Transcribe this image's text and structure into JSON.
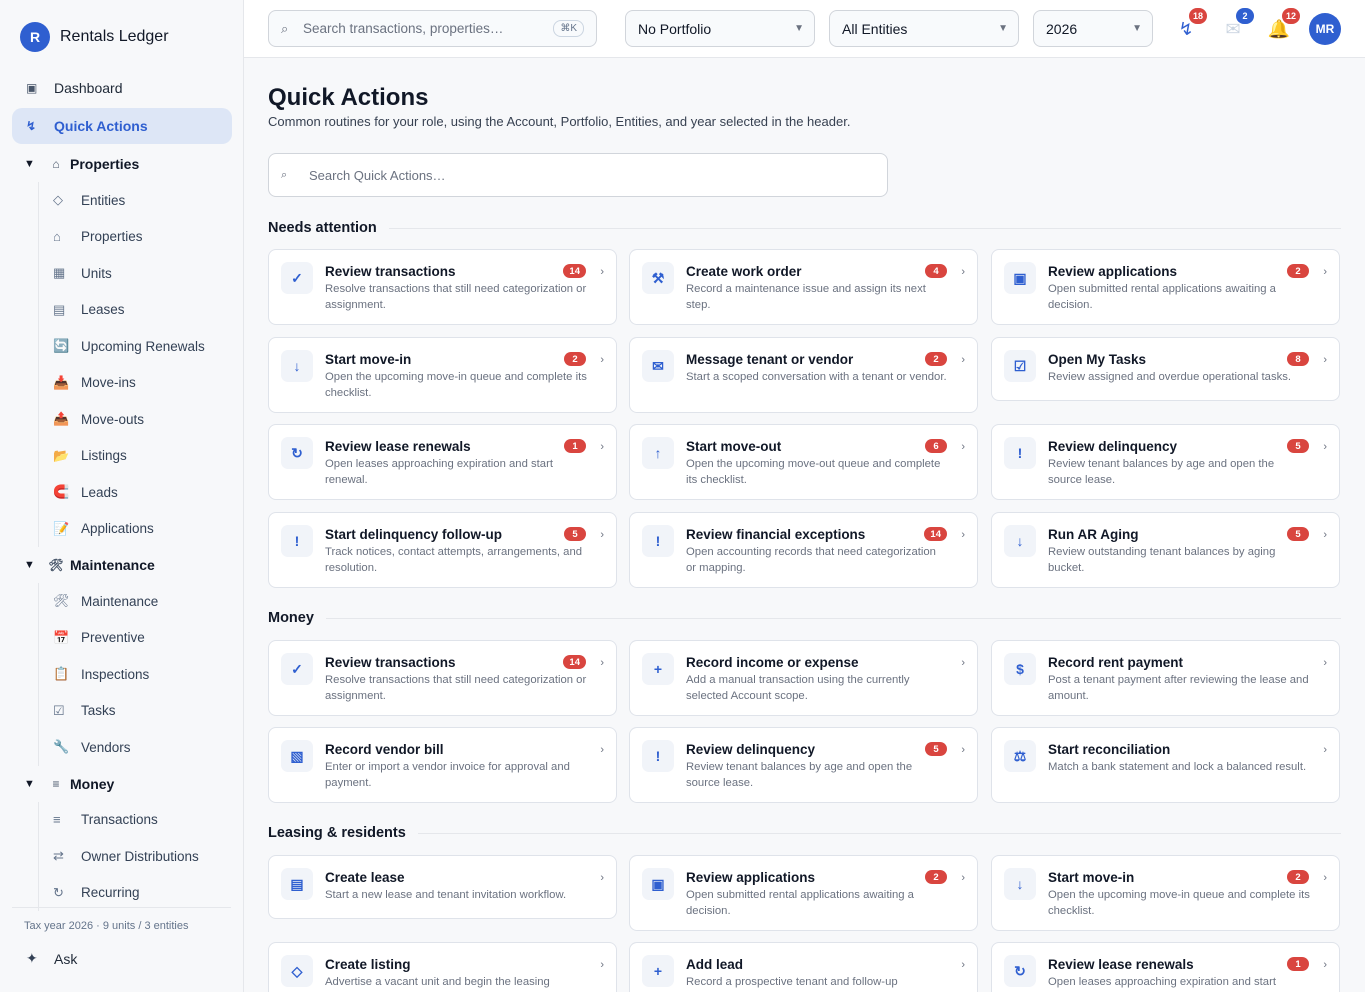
{
  "brand": {
    "initial": "R",
    "name": "Rentals Ledger"
  },
  "nav": [
    {
      "label": "Dashboard",
      "icon": "dashboard-icon",
      "glyph": "▣"
    },
    {
      "label": "Quick Actions",
      "icon": "lightning-icon",
      "glyph": "↯",
      "active": true
    }
  ],
  "groups": [
    {
      "label": "Properties",
      "icon": "home-icon",
      "glyph": "⌂",
      "items": [
        {
          "label": "Entities",
          "icon": "diamond-icon",
          "glyph": "◇"
        },
        {
          "label": "Properties",
          "icon": "home-icon",
          "glyph": "⌂"
        },
        {
          "label": "Units",
          "icon": "grid-icon",
          "glyph": "▦"
        },
        {
          "label": "Leases",
          "icon": "document-icon",
          "glyph": "▤"
        },
        {
          "label": "Upcoming Renewals",
          "icon": "renew-icon",
          "glyph": "🔄"
        },
        {
          "label": "Move-ins",
          "icon": "inbox-in-icon",
          "glyph": "📥"
        },
        {
          "label": "Move-outs",
          "icon": "inbox-out-icon",
          "glyph": "📤"
        },
        {
          "label": "Listings",
          "icon": "folder-icon",
          "glyph": "📂"
        },
        {
          "label": "Leads",
          "icon": "magnet-icon",
          "glyph": "🧲"
        },
        {
          "label": "Applications",
          "icon": "memo-icon",
          "glyph": "📝"
        }
      ]
    },
    {
      "label": "Maintenance",
      "icon": "tools-icon",
      "glyph": "🛠",
      "items": [
        {
          "label": "Maintenance",
          "icon": "tools-icon",
          "glyph": "🛠"
        },
        {
          "label": "Preventive",
          "icon": "calendar-icon",
          "glyph": "📅"
        },
        {
          "label": "Inspections",
          "icon": "clipboard-icon",
          "glyph": "📋"
        },
        {
          "label": "Tasks",
          "icon": "checkbox-icon",
          "glyph": "☑"
        },
        {
          "label": "Vendors",
          "icon": "wrench-icon",
          "glyph": "🔧"
        }
      ]
    },
    {
      "label": "Money",
      "icon": "money-icon",
      "glyph": "≡",
      "items": [
        {
          "label": "Transactions",
          "icon": "list-icon",
          "glyph": "≡"
        },
        {
          "label": "Owner Distributions",
          "icon": "transfer-icon",
          "glyph": "⇄"
        },
        {
          "label": "Recurring",
          "icon": "recurring-icon",
          "glyph": "↻"
        }
      ]
    }
  ],
  "sidebar_footer": "Tax year 2026 · 9 units / 3 entities",
  "ask": {
    "label": "Ask",
    "glyph": "✦"
  },
  "header": {
    "search_placeholder": "Search transactions, properties…",
    "search_shortcut": "⌘K",
    "portfolio": "No Portfolio",
    "entities": "All Entities",
    "year": "2026",
    "icons": [
      {
        "name": "lightning-icon",
        "glyph": "↯",
        "badge": "18",
        "badge_color": "#d9453f",
        "color": "#2f5fd0"
      },
      {
        "name": "mail-icon",
        "glyph": "✉",
        "badge": "2",
        "badge_color": "#2f5fd0",
        "color": "#cbd5e1"
      },
      {
        "name": "bell-icon",
        "glyph": "🔔",
        "badge": "12",
        "badge_color": "#d9453f",
        "color": "#eab308"
      }
    ],
    "avatar": "MR"
  },
  "page": {
    "title": "Quick Actions",
    "subtitle": "Common routines for your role, using the Account, Portfolio, Entities, and year selected in the header.",
    "search_placeholder": "Search Quick Actions…",
    "search_glyph": "⌕"
  },
  "sections": [
    {
      "title": "Needs attention",
      "cards": [
        {
          "title": "Review transactions",
          "desc": "Resolve transactions that still need categorization or assignment.",
          "badge": "14",
          "icon": "check-icon",
          "glyph": "✓"
        },
        {
          "title": "Create work order",
          "desc": "Record a maintenance issue and assign its next step.",
          "badge": "4",
          "icon": "tools-icon",
          "glyph": "⚒"
        },
        {
          "title": "Review applications",
          "desc": "Open submitted rental applications awaiting a decision.",
          "badge": "2",
          "icon": "application-icon",
          "glyph": "▣"
        },
        {
          "title": "Start move-in",
          "desc": "Open the upcoming move-in queue and complete its checklist.",
          "badge": "2",
          "icon": "arrow-down-icon",
          "glyph": "↓"
        },
        {
          "title": "Message tenant or vendor",
          "desc": "Start a scoped conversation with a tenant or vendor.",
          "badge": "2",
          "icon": "mail-icon",
          "glyph": "✉"
        },
        {
          "title": "Open My Tasks",
          "desc": "Review assigned and overdue operational tasks.",
          "badge": "8",
          "icon": "checkbox-icon",
          "glyph": "☑"
        },
        {
          "title": "Review lease renewals",
          "desc": "Open leases approaching expiration and start renewal.",
          "badge": "1",
          "icon": "refresh-icon",
          "glyph": "↻"
        },
        {
          "title": "Start move-out",
          "desc": "Open the upcoming move-out queue and complete its checklist.",
          "badge": "6",
          "icon": "arrow-up-icon",
          "glyph": "↑"
        },
        {
          "title": "Review delinquency",
          "desc": "Review tenant balances by age and open the source lease.",
          "badge": "5",
          "icon": "alert-icon",
          "glyph": "!"
        },
        {
          "title": "Start delinquency follow-up",
          "desc": "Track notices, contact attempts, arrangements, and resolution.",
          "badge": "5",
          "icon": "alert-icon",
          "glyph": "!"
        },
        {
          "title": "Review financial exceptions",
          "desc": "Open accounting records that need categorization or mapping.",
          "badge": "14",
          "icon": "alert-icon",
          "glyph": "!"
        },
        {
          "title": "Run AR Aging",
          "desc": "Review outstanding tenant balances by aging bucket.",
          "badge": "5",
          "icon": "arrow-down-icon",
          "glyph": "↓"
        }
      ]
    },
    {
      "title": "Money",
      "cards": [
        {
          "title": "Review transactions",
          "desc": "Resolve transactions that still need categorization or assignment.",
          "badge": "14",
          "icon": "check-icon",
          "glyph": "✓"
        },
        {
          "title": "Record income or expense",
          "desc": "Add a manual transaction using the currently selected Account scope.",
          "badge": "",
          "icon": "plus-icon",
          "glyph": "+"
        },
        {
          "title": "Record rent payment",
          "desc": "Post a tenant payment after reviewing the lease and amount.",
          "badge": "",
          "icon": "dollar-icon",
          "glyph": "$"
        },
        {
          "title": "Record vendor bill",
          "desc": "Enter or import a vendor invoice for approval and payment.",
          "badge": "",
          "icon": "bill-icon",
          "glyph": "▧"
        },
        {
          "title": "Review delinquency",
          "desc": "Review tenant balances by age and open the source lease.",
          "badge": "5",
          "icon": "alert-icon",
          "glyph": "!"
        },
        {
          "title": "Start reconciliation",
          "desc": "Match a bank statement and lock a balanced result.",
          "badge": "",
          "icon": "scale-icon",
          "glyph": "⚖"
        }
      ]
    },
    {
      "title": "Leasing & residents",
      "cards": [
        {
          "title": "Create lease",
          "desc": "Start a new lease and tenant invitation workflow.",
          "badge": "",
          "icon": "document-icon",
          "glyph": "▤"
        },
        {
          "title": "Review applications",
          "desc": "Open submitted rental applications awaiting a decision.",
          "badge": "2",
          "icon": "application-icon",
          "glyph": "▣"
        },
        {
          "title": "Start move-in",
          "desc": "Open the upcoming move-in queue and complete its checklist.",
          "badge": "2",
          "icon": "arrow-down-icon",
          "glyph": "↓"
        },
        {
          "title": "Create listing",
          "desc": "Advertise a vacant unit and begin the leasing",
          "badge": "",
          "icon": "diamond-icon",
          "glyph": "◇"
        },
        {
          "title": "Add lead",
          "desc": "Record a prospective tenant and follow-up",
          "badge": "",
          "icon": "plus-icon",
          "glyph": "+"
        },
        {
          "title": "Review lease renewals",
          "desc": "Open leases approaching expiration and start",
          "badge": "1",
          "icon": "refresh-icon",
          "glyph": "↻"
        }
      ]
    }
  ]
}
